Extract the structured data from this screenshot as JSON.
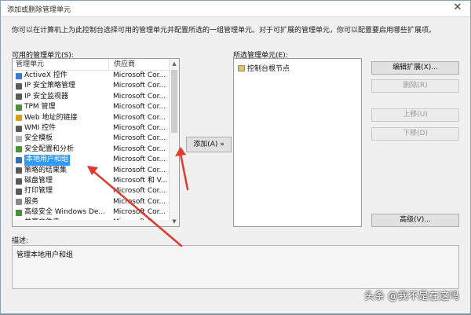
{
  "window": {
    "title": "添加或删除管理单元",
    "intro": "你可以在计算机上为此控制台选择可用的管理单元并配置所选的一组管理单元。对于可扩展的管理单元，你可以配置要启用哪些扩展项。"
  },
  "available": {
    "label": "可用的管理单元(S):",
    "col_name": "管理单元",
    "col_vendor": "供应商",
    "rows": [
      {
        "name": "ActiveX 控件",
        "vendor": "Microsoft Cor...",
        "icon_color": "#3a7bd5"
      },
      {
        "name": "IP 安全策略管理",
        "vendor": "Microsoft Cor...",
        "icon_color": "#5a5a5a"
      },
      {
        "name": "IP 安全监视器",
        "vendor": "Microsoft Cor...",
        "icon_color": "#5a5a5a"
      },
      {
        "name": "TPM 管理",
        "vendor": "Microsoft Cor...",
        "icon_color": "#4b8f3a"
      },
      {
        "name": "Web 地址的链接",
        "vendor": "Microsoft Cor...",
        "icon_color": "#d4a017"
      },
      {
        "name": "WMI 控件",
        "vendor": "Microsoft Cor...",
        "icon_color": "#5a5a5a"
      },
      {
        "name": "安全模板",
        "vendor": "Microsoft Cor...",
        "icon_color": "#b0b0b0"
      },
      {
        "name": "安全配置和分析",
        "vendor": "Microsoft Cor...",
        "icon_color": "#4b8f3a"
      },
      {
        "name": "本地用户和组",
        "vendor": "Microsoft Cor...",
        "icon_color": "#2f6fb0",
        "selected": true
      },
      {
        "name": "策略的结果集",
        "vendor": "Microsoft Cor...",
        "icon_color": "#5a5a5a"
      },
      {
        "name": "磁盘管理",
        "vendor": "Microsoft 和 V...",
        "icon_color": "#5a5a5a"
      },
      {
        "name": "打印管理",
        "vendor": "Microsoft Cor...",
        "icon_color": "#5a5a5a"
      },
      {
        "name": "服务",
        "vendor": "Microsoft Cor...",
        "icon_color": "#8a8a8a"
      },
      {
        "name": "高级安全 Windows De...",
        "vendor": "Microsoft Cor...",
        "icon_color": "#4b8f3a"
      },
      {
        "name": "共享文件夹",
        "vendor": "Microsoft Cor...",
        "icon_color": "#d4a017"
      }
    ]
  },
  "selected_snapins": {
    "label": "所选管理单元(E):",
    "root_node": "控制台根节点"
  },
  "buttons": {
    "add": "添加(A) »",
    "edit_extensions": "编辑扩展(X)...",
    "delete": "删除(R)",
    "move_up": "上移(U)",
    "move_down": "下移(D)",
    "advanced": "高级(V)..."
  },
  "description": {
    "label": "描述:",
    "text": "管理本地用户和组"
  },
  "watermark": "头条 @我不是在这吗"
}
